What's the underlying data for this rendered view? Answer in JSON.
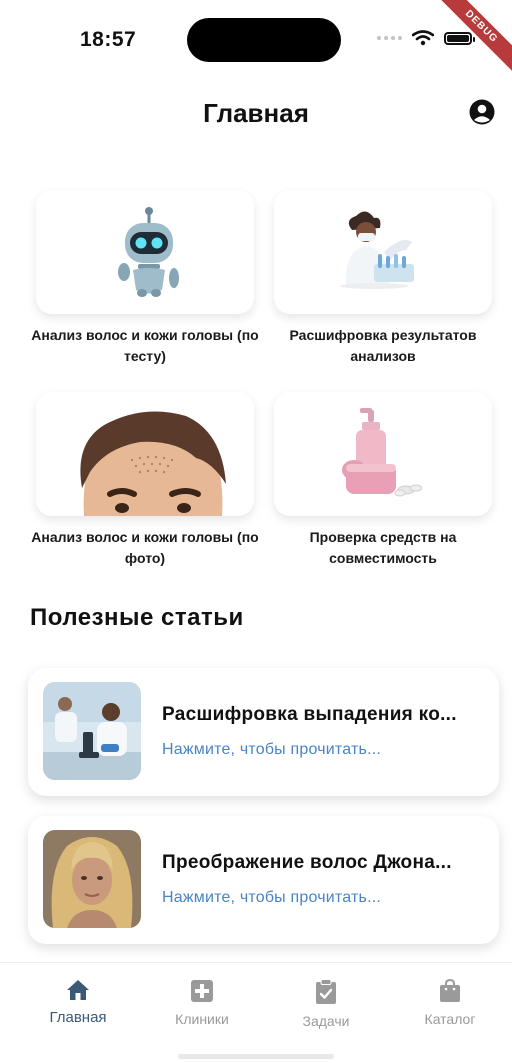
{
  "status_bar": {
    "time": "18:57",
    "debug_label": "DEBUG"
  },
  "header": {
    "title": "Главная"
  },
  "services": [
    {
      "label": "Анализ волос и кожи головы (по тесту)",
      "icon": "robot-icon"
    },
    {
      "label": "Расшифровка результатов анализов",
      "icon": "doctor-icon"
    },
    {
      "label": "Анализ волос и кожи головы (по фото)",
      "icon": "head-photo-icon"
    },
    {
      "label": "Проверка средств на совместимость",
      "icon": "cosmetics-icon"
    }
  ],
  "articles_section": {
    "title": "Полезные статьи",
    "items": [
      {
        "title": "Расшифровка выпадения ко...",
        "subtitle": "Нажмите, чтобы прочитать..."
      },
      {
        "title": "Преображение волос Джона...",
        "subtitle": "Нажмите, чтобы прочитать..."
      }
    ]
  },
  "bottom_nav": {
    "items": [
      {
        "label": "Главная",
        "icon": "home-icon",
        "active": true
      },
      {
        "label": "Клиники",
        "icon": "medical-cross-icon",
        "active": false
      },
      {
        "label": "Задачи",
        "icon": "clipboard-check-icon",
        "active": false
      },
      {
        "label": "Каталог",
        "icon": "shopping-bag-icon",
        "active": false
      }
    ]
  },
  "colors": {
    "accent": "#3a5a78",
    "link": "#4a84c4",
    "inactive": "#9a9a9a",
    "debug_banner": "#b93a3a"
  }
}
